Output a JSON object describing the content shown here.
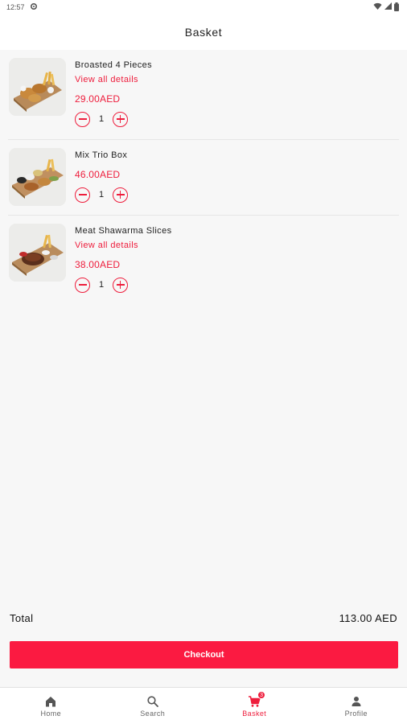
{
  "status_bar": {
    "time": "12:57"
  },
  "header": {
    "title": "Basket"
  },
  "items": [
    {
      "name": "Broasted 4 Pieces",
      "link": "View all details",
      "price": "29.00AED",
      "quantity": "1"
    },
    {
      "name": "Mix Trio Box",
      "link": "",
      "price": "46.00AED",
      "quantity": "1"
    },
    {
      "name": "Meat Shawarma Slices",
      "link": "View all details",
      "price": "38.00AED",
      "quantity": "1"
    }
  ],
  "summary": {
    "total_label": "Total",
    "total_value": "113.00 AED"
  },
  "checkout": {
    "label": "Checkout"
  },
  "nav": {
    "items": [
      {
        "label": "Home",
        "icon": "home-icon"
      },
      {
        "label": "Search",
        "icon": "search-icon"
      },
      {
        "label": "Basket",
        "icon": "cart-icon",
        "badge": "3"
      },
      {
        "label": "Profile",
        "icon": "person-icon"
      }
    ],
    "active_index": 2
  },
  "colors": {
    "accent": "#ee1d3c",
    "checkout_bg": "#fb1a41",
    "background": "#f7f7f7"
  }
}
